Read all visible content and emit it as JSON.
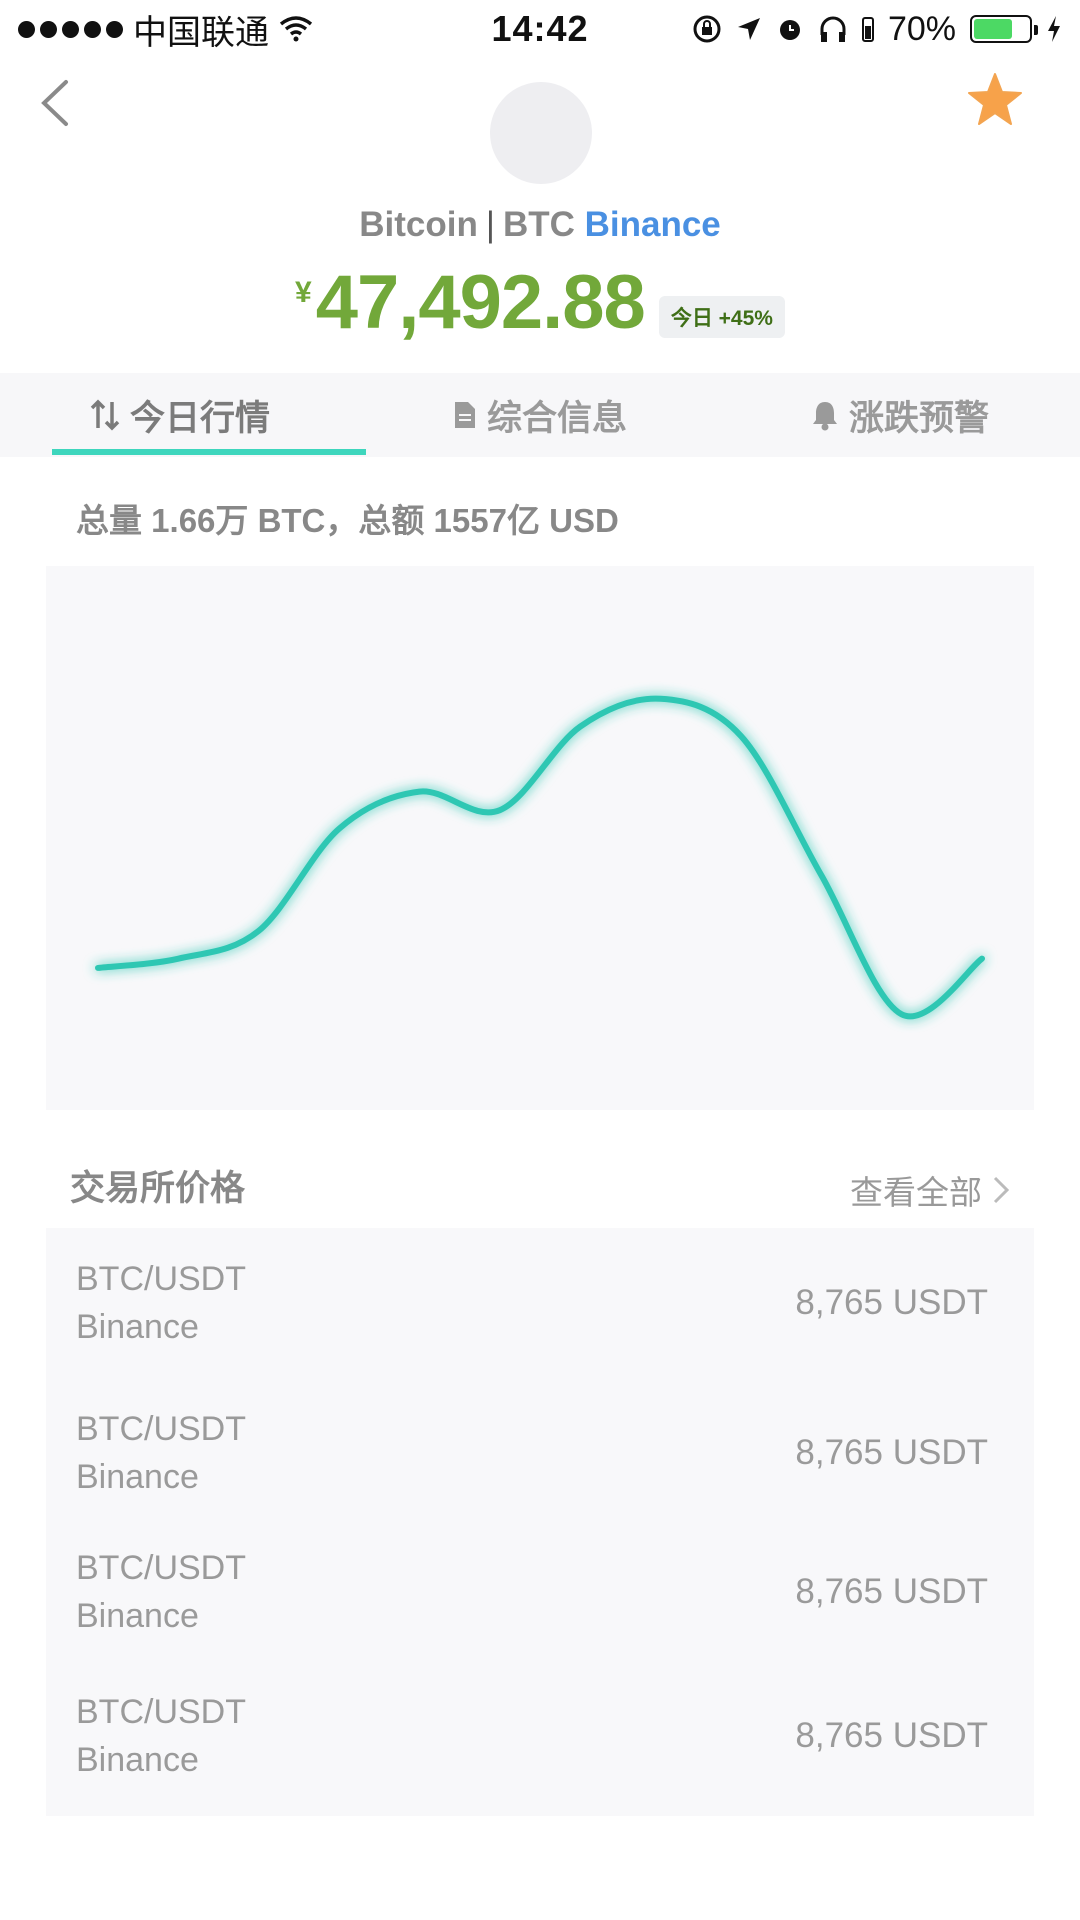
{
  "status_bar": {
    "carrier": "中国联通",
    "time": "14:42",
    "battery_percent": "70%",
    "battery_level": 0.7,
    "icons": [
      "signal-icon",
      "wifi-icon",
      "orientation-lock-icon",
      "location-icon",
      "alarm-icon",
      "headphones-icon",
      "battery-icon",
      "charging-icon"
    ]
  },
  "header": {
    "coin_name": "Bitcoin",
    "separator": "|",
    "symbol": "BTC",
    "exchange": "Binance",
    "currency_symbol": "¥",
    "price": "47,492.88",
    "change_badge": "今日 +45%",
    "colors": {
      "price": "#72a83a",
      "exchange": "#4a90e2",
      "star": "#f7a24a"
    }
  },
  "tabs": [
    {
      "label": "今日行情",
      "icon": "trend-arrows-icon",
      "active": true
    },
    {
      "label": "综合信息",
      "icon": "document-icon",
      "active": false
    },
    {
      "label": "涨跌预警",
      "icon": "bell-icon",
      "active": false
    }
  ],
  "summary": "总量 1.66万 BTC，总额 1557亿 USD",
  "chart_data": {
    "type": "line",
    "x": [
      0,
      1,
      2,
      3,
      4,
      5,
      6,
      7,
      8,
      9,
      10,
      11
    ],
    "series": [
      {
        "values": [
          22,
          24,
          30,
          52,
          60,
          56,
          74,
          80,
          72,
          42,
          12,
          24
        ]
      }
    ],
    "ylim": [
      0,
      100
    ],
    "grid": false,
    "line_color": "#2fc7b3"
  },
  "exchanges": {
    "title": "交易所价格",
    "view_all": "查看全部",
    "rows": [
      {
        "pair": "BTC/USDT",
        "exchange": "Binance",
        "price": "8,765 USDT"
      },
      {
        "pair": "BTC/USDT",
        "exchange": "Binance",
        "price": "8,765 USDT"
      },
      {
        "pair": "BTC/USDT",
        "exchange": "Binance",
        "price": "8,765 USDT"
      },
      {
        "pair": "BTC/USDT",
        "exchange": "Binance",
        "price": "8,765 USDT"
      }
    ]
  }
}
